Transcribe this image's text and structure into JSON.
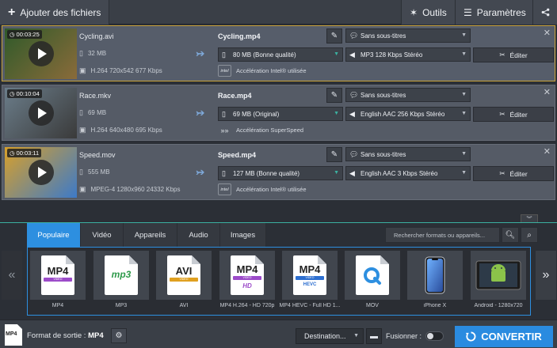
{
  "toolbar": {
    "add_files": "Ajouter des fichiers",
    "tools": "Outils",
    "settings": "Paramètres"
  },
  "files": [
    {
      "duration": "00:03:25",
      "source_name": "Cycling.avi",
      "source_size": "32 MB",
      "source_codec": "H.264 720x542 677 Kbps",
      "output_name": "Cycling.mp4",
      "output_size": "80 MB (Bonne qualité)",
      "subtitles": "Sans sous-titres",
      "audio": "MP3 128 Kbps Stéréo",
      "acceleration": "Accélération Intel® utilisée",
      "accel_icon": "intel",
      "edit": "Éditer",
      "selected": true,
      "thumb_colors": [
        "#2f5a2a",
        "#8a6b3a"
      ]
    },
    {
      "duration": "00:10:04",
      "source_name": "Race.mkv",
      "source_size": "69 MB",
      "source_codec": "H.264 640x480 695 Kbps",
      "output_name": "Race.mp4",
      "output_size": "69 MB (Original)",
      "subtitles": "Sans sous-titres",
      "audio": "English AAC 256 Kbps Stéréo",
      "acceleration": "Accélération SuperSpeed",
      "accel_icon": "superspeed",
      "edit": "Éditer",
      "selected": false,
      "thumb_colors": [
        "#6b7d8a",
        "#3a3a3a"
      ]
    },
    {
      "duration": "00:03:11",
      "source_name": "Speed.mov",
      "source_size": "555 MB",
      "source_codec": "MPEG-4 1280x960 24332 Kbps",
      "output_name": "Speed.mp4",
      "output_size": "127 MB (Bonne qualité)",
      "subtitles": "Sans sous-titres",
      "audio": "English AAC 3 Kbps Stéréo",
      "acceleration": "Accélération Intel® utilisée",
      "accel_icon": "intel",
      "edit": "Éditer",
      "selected": false,
      "thumb_colors": [
        "#d8a02a",
        "#3d7ac8"
      ]
    }
  ],
  "tabs": [
    "Populaire",
    "Vidéo",
    "Appareils",
    "Audio",
    "Images"
  ],
  "active_tab": "Populaire",
  "search": {
    "placeholder": "Rechercher formats ou appareils..."
  },
  "formats": [
    {
      "label": "MP4",
      "icon": "MP4"
    },
    {
      "label": "MP3",
      "icon": "mp3"
    },
    {
      "label": "AVI",
      "icon": "AVI"
    },
    {
      "label": "MP4 H.264 - HD 720p",
      "icon": "MP4 HD"
    },
    {
      "label": "MP4 HEVC - Full HD 1...",
      "icon": "MP4 HEVC"
    },
    {
      "label": "MOV",
      "icon": "quicktime"
    },
    {
      "label": "iPhone X",
      "icon": "iphone"
    },
    {
      "label": "Android - 1280x720",
      "icon": "android"
    }
  ],
  "bottom": {
    "output_format_label": "Format de sortie : ",
    "output_format_value": "MP4",
    "destination": "Destination...",
    "merge": "Fusionner :",
    "convert": "CONVERTIR",
    "output_doc_icon": "MP4"
  },
  "colors": {
    "accent": "#2d8fe0",
    "selected_border": "#c9a33a",
    "panel_line": "#3bb0a0"
  }
}
